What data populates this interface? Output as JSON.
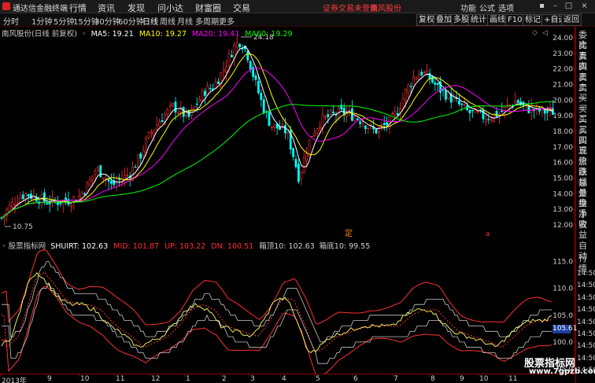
{
  "titlebar": {
    "app_name": "通达信金融终端",
    "menus": [
      "行情",
      "资讯",
      "发现",
      "问小达",
      "财富圈",
      "交易"
    ],
    "notice": "证券交易未登录",
    "stock_name": "南风股份",
    "right_menus": [
      "功能",
      "公式",
      "选项"
    ],
    "window_buttons": [
      "▪",
      "–",
      "□",
      "×"
    ]
  },
  "periodbar": {
    "periods": [
      "分时",
      "1分钟",
      "5分钟",
      "15分钟",
      "30分钟",
      "60分钟",
      "日线",
      "周线",
      "月线",
      "多周期",
      "更多"
    ],
    "active": "日线",
    "right_tabs": [
      "复权",
      "叠加",
      "多股",
      "统计",
      "画线",
      "F10",
      "标记",
      "+自选",
      "返回"
    ]
  },
  "main_chart": {
    "stock_label": "南风股份(日线 前复权)",
    "ma_legend": [
      {
        "label": "MA5: 19.21",
        "color": "#ffffff"
      },
      {
        "label": "MA10: 19.27",
        "color": "#ffff00"
      },
      {
        "label": "MA20: 19.41",
        "color": "#ff00ff"
      },
      {
        "label": "MA60: 19.29",
        "color": "#00ff00"
      }
    ],
    "high_annotation": "24.18",
    "low_annotation": "10.75",
    "y_ticks": [
      "24.00",
      "23.00",
      "22.00",
      "21.00",
      "20.00",
      "19.00",
      "18.00",
      "17.00",
      "16.00",
      "15.00",
      "14.00",
      "13.00",
      "12.00"
    ],
    "ylim": [
      11.5,
      24.4
    ],
    "markers": [
      "定",
      "a"
    ],
    "colors": {
      "up": "#ff3030",
      "down": "#00ffff",
      "ma5": "#ffffff",
      "ma10": "#ffff00",
      "ma20": "#ff00ff",
      "ma60": "#00ff00"
    }
  },
  "indicator": {
    "name_label": "股票指标网",
    "values": [
      {
        "label": "SHUIRT: 102.63",
        "color": "#ffffff"
      },
      {
        "label": "MID: 101.87",
        "color": "#ff3030"
      },
      {
        "label": "UP: 103.22",
        "color": "#ff3030"
      },
      {
        "label": "DN: 100.51",
        "color": "#ff3030"
      },
      {
        "label": "箱顶10: 102.63",
        "color": "#d0d0d0"
      },
      {
        "label": "箱底10: 99.55",
        "color": "#d0d0d0"
      }
    ],
    "y_ticks": [
      "115.0",
      "110.0",
      "105.0",
      "100.0",
      "95.0"
    ],
    "price_tag": "105.61"
  },
  "right_panel": {
    "items": [
      "委比",
      "卖五",
      "卖四",
      "卖三",
      "卖二",
      "卖一",
      "买一",
      "买二",
      "买三",
      "买四",
      "买五",
      "现价",
      "涨跌",
      "涨幅",
      "总量",
      "外盘",
      "换手",
      "净资",
      "收益",
      "自动",
      "行情",
      "14:50",
      "14:50",
      "14:50",
      "14:50",
      "14:50",
      "14:50",
      "14:50",
      "14:50",
      "14:50"
    ]
  },
  "x_axis": {
    "labels": [
      "2013年",
      "9",
      "10",
      "11",
      "12",
      "1",
      "2",
      "3",
      "4",
      "5",
      "6",
      "7",
      "8",
      "9",
      "10",
      "11"
    ]
  },
  "watermark": {
    "line1": "股票指标网",
    "line2": "www.7gpzb.com"
  }
}
